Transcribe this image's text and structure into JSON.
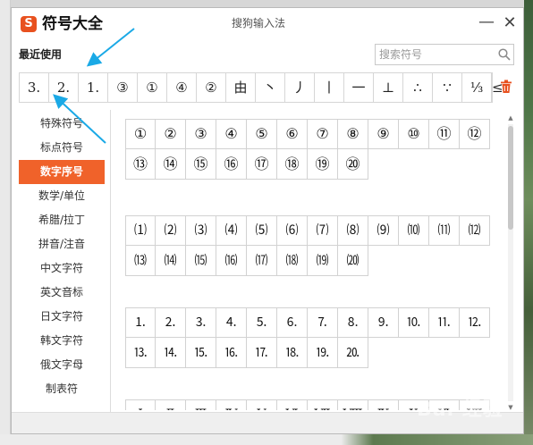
{
  "app": {
    "logo_glyph": "S",
    "title": "符号大全",
    "window_title": "搜狗输入法",
    "minimize_glyph": "—",
    "close_glyph": "✕",
    "accent_color": "#f0622a"
  },
  "recent": {
    "title": "最近使用",
    "items": [
      "3.",
      "2.",
      "1.",
      "③",
      "①",
      "④",
      "②",
      "由",
      "丶",
      "丿",
      "丨",
      "一",
      "⊥",
      "∴",
      "∵",
      "⅓",
      "≤"
    ],
    "clear_icon": "trash-icon"
  },
  "search": {
    "placeholder": "搜索符号",
    "icon": "search-icon"
  },
  "sidebar": {
    "items": [
      {
        "label": "特殊符号"
      },
      {
        "label": "标点符号"
      },
      {
        "label": "数字序号",
        "active": true
      },
      {
        "label": "数学/单位"
      },
      {
        "label": "希腊/拉丁"
      },
      {
        "label": "拼音/注音"
      },
      {
        "label": "中文字符"
      },
      {
        "label": "英文音标"
      },
      {
        "label": "日文字符"
      },
      {
        "label": "韩文字符"
      },
      {
        "label": "俄文字母"
      },
      {
        "label": "制表符"
      }
    ]
  },
  "groups": [
    {
      "name": "circled-numbers",
      "symbols": [
        "①",
        "②",
        "③",
        "④",
        "⑤",
        "⑥",
        "⑦",
        "⑧",
        "⑨",
        "⑩",
        "⑪",
        "⑫",
        "⑬",
        "⑭",
        "⑮",
        "⑯",
        "⑰",
        "⑱",
        "⑲",
        "⑳"
      ]
    },
    {
      "name": "parenthesized-numbers",
      "symbols": [
        "⑴",
        "⑵",
        "⑶",
        "⑷",
        "⑸",
        "⑹",
        "⑺",
        "⑻",
        "⑼",
        "⑽",
        "⑾",
        "⑿",
        "⒀",
        "⒁",
        "⒂",
        "⒃",
        "⒄",
        "⒅",
        "⒆",
        "⒇"
      ]
    },
    {
      "name": "full-stop-numbers",
      "symbols": [
        "⒈",
        "⒉",
        "⒊",
        "⒋",
        "⒌",
        "⒍",
        "⒎",
        "⒏",
        "⒐",
        "⒑",
        "⒒",
        "⒓",
        "⒔",
        "⒕",
        "⒖",
        "⒗",
        "⒘",
        "⒙",
        "⒚",
        "⒛"
      ]
    },
    {
      "name": "roman-numerals",
      "symbols": [
        "Ⅰ",
        "Ⅱ",
        "Ⅲ",
        "Ⅳ",
        "Ⅴ",
        "Ⅵ",
        "Ⅶ",
        "Ⅷ",
        "Ⅸ",
        "Ⅹ",
        "Ⅺ",
        "Ⅻ"
      ]
    }
  ],
  "watermark": "Bai 经验"
}
